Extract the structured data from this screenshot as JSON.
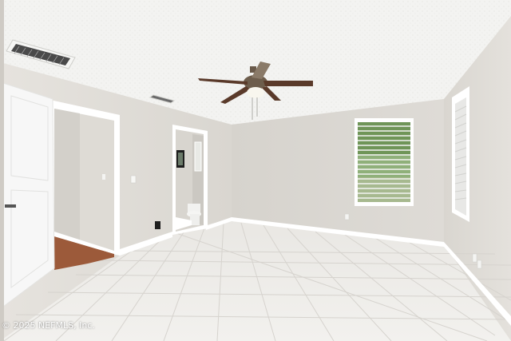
{
  "photo": {
    "watermark": "© 2025 NEFMLS, Inc.",
    "palette": {
      "ceiling": "#f3f3f1",
      "back_wall": "#dcd9d3",
      "side_wall": "#e2dfda",
      "floor": "#efedea",
      "grout": "#d8d5d0",
      "baseboard": "#ffffff",
      "door": "#f7f7f7",
      "hardwood": "#9c5a3a",
      "fan_blade": "#5a3a2a",
      "window_glass": "#8fb07a"
    }
  }
}
